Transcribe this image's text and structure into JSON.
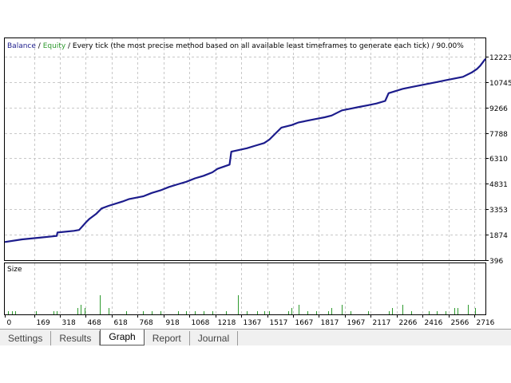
{
  "header": {
    "balance_label": "Balance",
    "sep1": " / ",
    "equity_label": "Equity",
    "rest": " / Every tick (the most precise method based on all available least timeframes to generate each tick) / 90.00%"
  },
  "size_label": "Size",
  "colors": {
    "balance": "#1c1c8c",
    "equity": "#2e9a2e",
    "size_bars": "#2e9a2e",
    "grid": "#c8c8c8",
    "tab_bg": "#f0f0f0"
  },
  "tabs": [
    {
      "label": "Settings",
      "active": false
    },
    {
      "label": "Results",
      "active": false
    },
    {
      "label": "Graph",
      "active": true
    },
    {
      "label": "Report",
      "active": false
    },
    {
      "label": "Journal",
      "active": false
    }
  ],
  "chart_data": {
    "type": "line",
    "ylim": [
      396,
      12223
    ],
    "xlim": [
      0,
      2780
    ],
    "y_ticks": [
      "12223",
      "10745",
      "9266",
      "7788",
      "6310",
      "4831",
      "3353",
      "1874",
      "396"
    ],
    "y_tick_values": [
      12223,
      10745,
      9266,
      7788,
      6310,
      4831,
      3353,
      1874,
      396
    ],
    "x_ticks": [
      "0",
      "169",
      "318",
      "468",
      "618",
      "768",
      "918",
      "1068",
      "1218",
      "1367",
      "1517",
      "1667",
      "1817",
      "1967",
      "2117",
      "2266",
      "2416",
      "2566",
      "2716"
    ],
    "x_tick_values": [
      0,
      169,
      318,
      468,
      618,
      768,
      918,
      1068,
      1218,
      1367,
      1517,
      1667,
      1817,
      1967,
      2117,
      2266,
      2416,
      2566,
      2716
    ],
    "series": [
      {
        "name": "Balance",
        "x": [
          0,
          100,
          200,
          300,
          305,
          400,
          430,
          470,
          490,
          530,
          560,
          600,
          680,
          720,
          800,
          850,
          900,
          950,
          1000,
          1050,
          1100,
          1150,
          1200,
          1230,
          1300,
          1310,
          1400,
          1450,
          1500,
          1530,
          1600,
          1660,
          1700,
          1800,
          1850,
          1890,
          1950,
          2000,
          2050,
          2100,
          2150,
          2200,
          2220,
          2300,
          2350,
          2400,
          2450,
          2500,
          2550,
          2600,
          2650,
          2700,
          2730,
          2750,
          2780
        ],
        "y": [
          1450,
          1600,
          1700,
          1800,
          2000,
          2100,
          2150,
          2600,
          2800,
          3100,
          3400,
          3550,
          3800,
          3950,
          4100,
          4300,
          4450,
          4650,
          4800,
          4950,
          5150,
          5300,
          5500,
          5700,
          5950,
          6700,
          6900,
          7050,
          7200,
          7400,
          8100,
          8250,
          8400,
          8600,
          8700,
          8800,
          9100,
          9200,
          9300,
          9400,
          9500,
          9650,
          10100,
          10350,
          10450,
          10550,
          10650,
          10750,
          10850,
          10950,
          11050,
          11300,
          11500,
          11700,
          12100
        ]
      }
    ],
    "size_bars": {
      "x": [
        20,
        40,
        60,
        180,
        280,
        300,
        420,
        440,
        460,
        550,
        600,
        700,
        800,
        850,
        900,
        1000,
        1050,
        1100,
        1150,
        1200,
        1280,
        1350,
        1400,
        1460,
        1500,
        1530,
        1640,
        1660,
        1700,
        1750,
        1800,
        1870,
        1890,
        1950,
        2000,
        2100,
        2220,
        2240,
        2300,
        2350,
        2450,
        2500,
        2550,
        2600,
        2620,
        2680,
        2720
      ],
      "y": [
        1,
        1,
        1,
        1,
        1,
        1,
        2,
        3,
        2,
        6,
        2,
        1,
        1,
        1,
        1,
        1,
        1,
        1,
        1,
        1,
        1,
        6,
        1,
        1,
        1,
        1,
        1,
        2,
        3,
        1,
        1,
        1,
        2,
        3,
        1,
        1,
        1,
        2,
        3,
        1,
        1,
        1,
        1,
        2,
        2,
        3,
        2
      ]
    }
  }
}
